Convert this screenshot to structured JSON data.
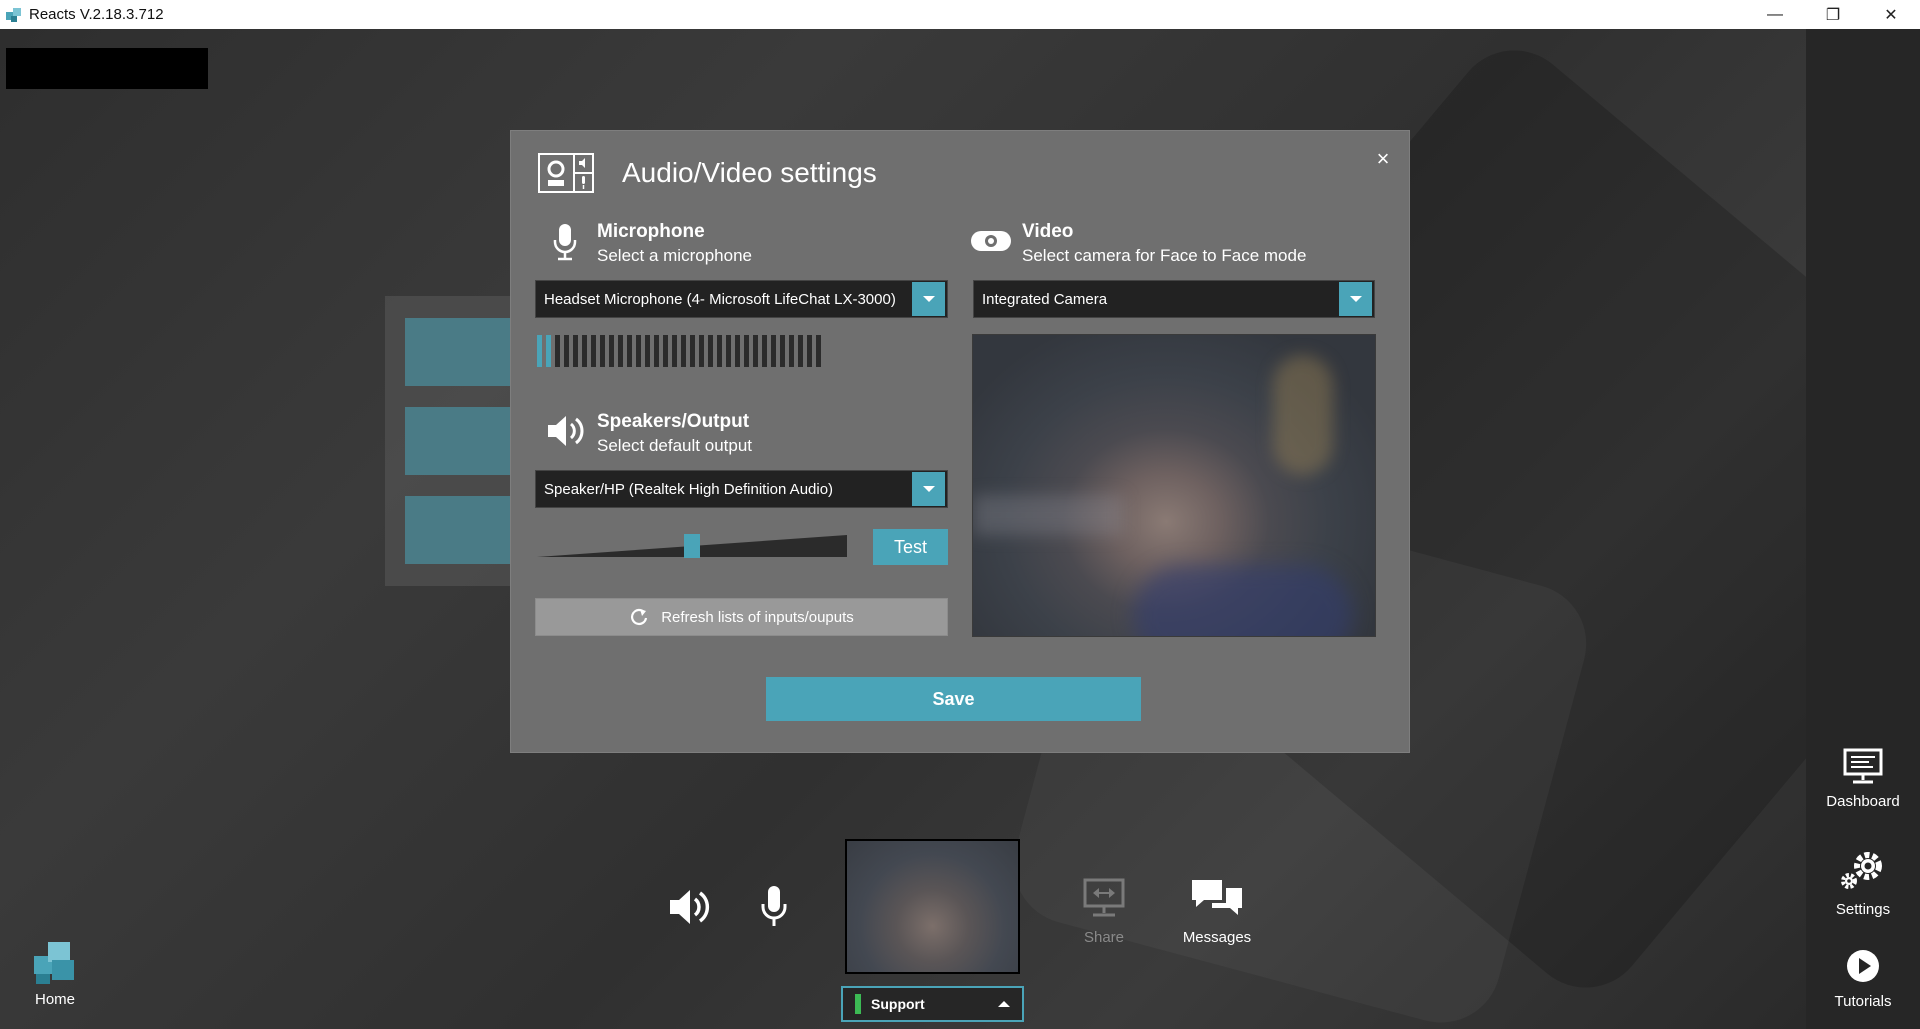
{
  "window": {
    "title": "Reacts V.2.18.3.712",
    "minimize_glyph": "—",
    "restore_glyph": "❐",
    "close_glyph": "✕"
  },
  "modal": {
    "title": "Audio/Video settings",
    "close_glyph": "×",
    "microphone": {
      "title": "Microphone",
      "subtitle": "Select a microphone",
      "selected": "Headset Microphone (4- Microsoft LifeChat LX-3000)",
      "level_fraction": 0.06
    },
    "speakers": {
      "title": "Speakers/Output",
      "subtitle": "Select default output",
      "selected": "Speaker/HP (Realtek High Definition Audio)",
      "volume_fraction": 0.5,
      "test_label": "Test"
    },
    "video": {
      "title": "Video",
      "subtitle": "Select camera for Face to Face mode",
      "selected": "Integrated Camera"
    },
    "refresh_label": "Refresh lists of inputs/ouputs",
    "save_label": "Save"
  },
  "bottom_bar": {
    "home_label": "Home",
    "share_label": "Share",
    "messages_label": "Messages",
    "support_label": "Support"
  },
  "right_rail": {
    "dashboard_label": "Dashboard",
    "settings_label": "Settings",
    "tutorials_label": "Tutorials"
  },
  "colors": {
    "accent": "#4aa4b8",
    "status_green": "#3cba54"
  }
}
